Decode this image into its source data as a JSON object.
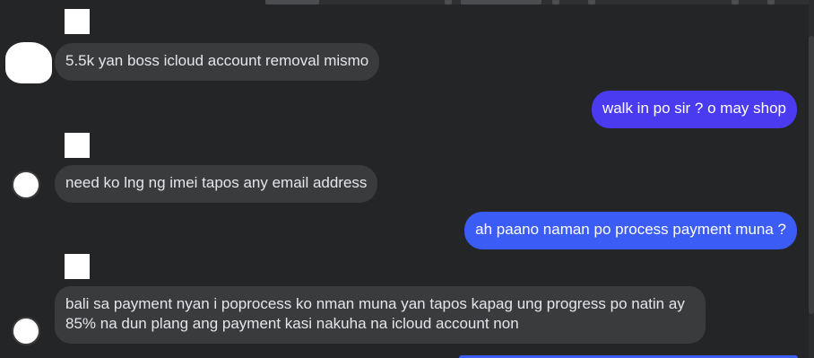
{
  "conversation": {
    "messages": [
      {
        "direction": "incoming",
        "text": "5.5k yan boss icloud account removal mismo"
      },
      {
        "direction": "outgoing",
        "text": "walk in po sir ? o may shop"
      },
      {
        "direction": "incoming",
        "text": "need ko lng ng imei tapos any email address"
      },
      {
        "direction": "outgoing",
        "text": "ah paano naman po process payment muna ?"
      },
      {
        "direction": "incoming",
        "text": "bali sa payment nyan i poprocess ko nman muna yan tapos kapag ung progress po natin ay 85% na dun plang ang payment kasi nakuha na icloud account non"
      }
    ]
  },
  "colors": {
    "background": "#242526",
    "incoming_bubble": "#3a3b3c",
    "outgoing_bubble_1": "#4a3af0",
    "outgoing_bubble_2": "#3b5cf5",
    "text_light": "#e4e6eb"
  }
}
